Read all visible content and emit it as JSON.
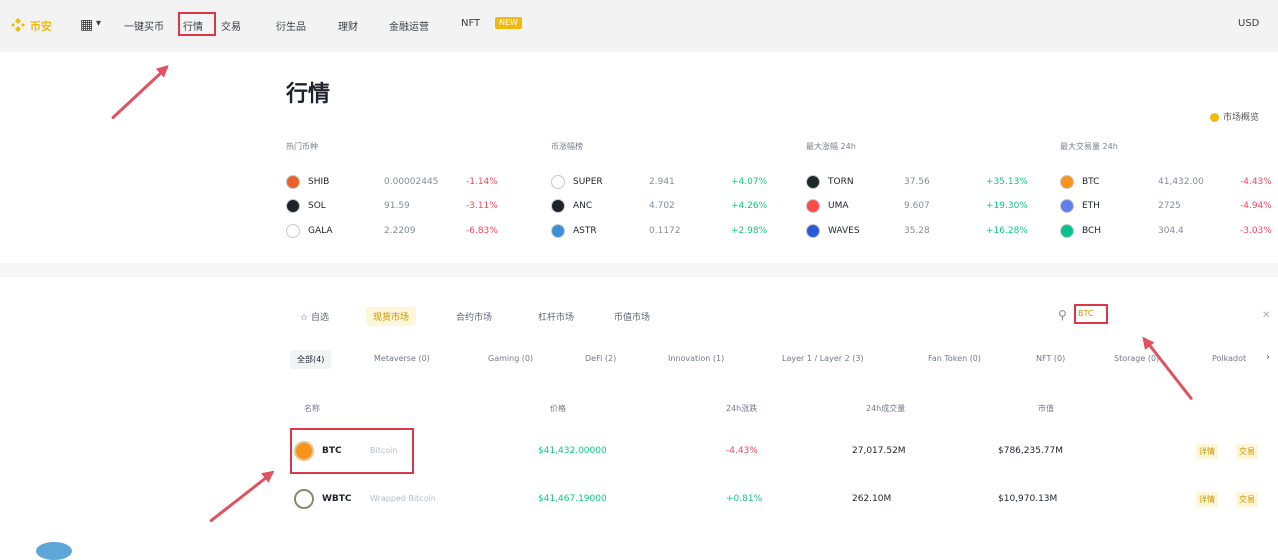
{
  "topnav": {
    "logo": "币安",
    "items": [
      "一键买币",
      "行情",
      "交易",
      "衍生品",
      "理财",
      "金融运营",
      "NFT"
    ],
    "new_badge": "NEW",
    "right_menu": "USD"
  },
  "page": {
    "title": "行情",
    "favorites_link": "市场概览"
  },
  "sections": [
    {
      "title": "热门币种",
      "rows": [
        {
          "coin": "SHIB",
          "price": "0.00002445",
          "change": "-1.14%",
          "icon_color": "#e8622a"
        },
        {
          "coin": "SOL",
          "price": "91.59",
          "change": "-3.11%",
          "icon_color": "#1e2329"
        },
        {
          "coin": "GALA",
          "price": "2.2209",
          "change": "-6.83%",
          "icon_color": "#ffffff"
        }
      ]
    },
    {
      "title": "币涨幅榜",
      "rows": [
        {
          "coin": "SUPER",
          "price": "2.941",
          "change": "+4.07%",
          "icon_color": "#ffffff"
        },
        {
          "coin": "ANC",
          "price": "4.702",
          "change": "+4.26%",
          "icon_color": "#1e2329"
        },
        {
          "coin": "ASTR",
          "price": "0.1172",
          "change": "+2.98%",
          "icon_color": "#3b8fd9"
        }
      ]
    },
    {
      "title": "最大涨幅 24h",
      "rows": [
        {
          "coin": "TORN",
          "price": "37.56",
          "change": "+35.13%",
          "icon_color": "#1a2a2a"
        },
        {
          "coin": "UMA",
          "price": "9.607",
          "change": "+19.30%",
          "icon_color": "#ff4a4a"
        },
        {
          "coin": "WAVES",
          "price": "35.28",
          "change": "+16.28%",
          "icon_color": "#2a5ada"
        }
      ]
    },
    {
      "title": "最大交易量 24h",
      "rows": [
        {
          "coin": "BTC",
          "price": "41,432.00",
          "change": "-4.43%",
          "icon_color": "#f7931a"
        },
        {
          "coin": "ETH",
          "price": "2725",
          "change": "-4.94%",
          "icon_color": "#627eea"
        },
        {
          "coin": "BCH",
          "price": "304.4",
          "change": "-3.03%",
          "icon_color": "#0ac18e"
        }
      ]
    }
  ],
  "tabs": {
    "items": [
      "自选",
      "现货市场",
      "合约市场",
      "杠杆市场",
      "币值市场"
    ],
    "active_index": 1,
    "search_value": "BTC"
  },
  "categories": {
    "items": [
      "全部(4)",
      "Metaverse (0)",
      "Gaming (0)",
      "DeFi (2)",
      "Innovation (1)",
      "Layer 1 / Layer 2 (3)",
      "Fan Token (0)",
      "NFT (0)",
      "Storage (0)",
      "Polkadot"
    ],
    "active_index": 0
  },
  "table": {
    "headers": [
      "名称",
      "价格",
      "24h涨跌",
      "24h成交量",
      "市值"
    ],
    "rows": [
      {
        "symbol": "BTC",
        "name": "Bitcoin",
        "price": "$41,432.00000",
        "change": "-4.43%",
        "volume": "27,017.52M",
        "mcap": "$786,235.77M",
        "icon_color": "#f7931a",
        "actions": [
          "详情",
          "交易"
        ]
      },
      {
        "symbol": "WBTC",
        "name": "Wrapped Bitcoin",
        "price": "$41,467.19000",
        "change": "+0.81%",
        "volume": "262.10M",
        "mcap": "$10,970.13M",
        "icon_color": "#ffffff",
        "actions": [
          "详情",
          "交易"
        ]
      }
    ]
  }
}
